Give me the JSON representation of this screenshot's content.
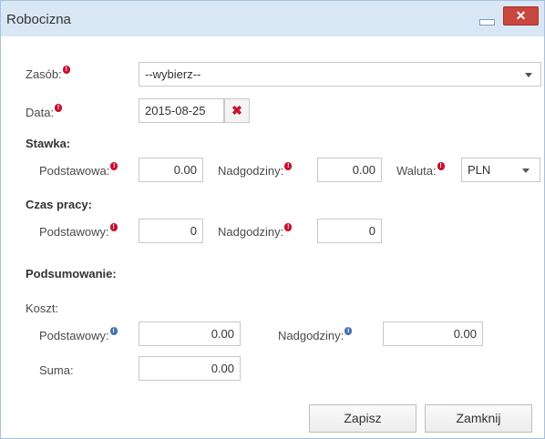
{
  "window": {
    "title": "Robocizna"
  },
  "form": {
    "resource": {
      "label": "Zasób:",
      "value": "--wybierz--"
    },
    "date": {
      "label": "Data:",
      "value": "2015-08-25"
    }
  },
  "rate": {
    "heading": "Stawka:",
    "base": {
      "label": "Podstawowa:",
      "value": "0.00"
    },
    "overtime": {
      "label": "Nadgodziny:",
      "value": "0.00"
    },
    "currency": {
      "label": "Waluta:",
      "value": "PLN"
    }
  },
  "work_time": {
    "heading": "Czas pracy:",
    "base": {
      "label": "Podstawowy:",
      "value": "0"
    },
    "overtime": {
      "label": "Nadgodziny:",
      "value": "0"
    }
  },
  "summary": {
    "heading": "Podsumowanie:",
    "cost_label": "Koszt:",
    "base": {
      "label": "Podstawowy:",
      "value": "0.00"
    },
    "overtime": {
      "label": "Nadgodziny:",
      "value": "0.00"
    },
    "total": {
      "label": "Suma:",
      "value": "0.00"
    }
  },
  "buttons": {
    "save": "Zapisz",
    "close": "Zamknij"
  },
  "icons": {
    "required": "required-icon",
    "info": "info-icon",
    "clear": "clear-date-icon"
  },
  "colors": {
    "titlebar": "#d9e6f4",
    "close": "#c9473d",
    "required": "#c8102e",
    "info": "#4a6fb3"
  }
}
